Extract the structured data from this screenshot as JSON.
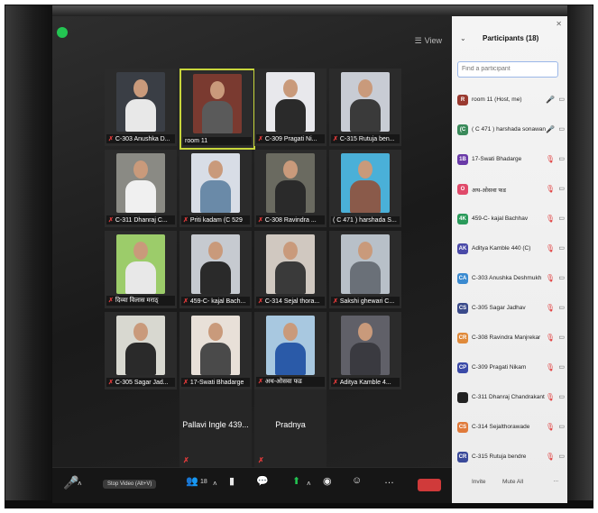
{
  "view_label": "View",
  "gallery": [
    {
      "name": "C-303 Anushka D...",
      "muted": true,
      "bg": "#3a3e45",
      "shirt": "#e8e8e8",
      "active": false
    },
    {
      "name": "room 11",
      "muted": false,
      "bg": "#7a3a30",
      "shirt": "#5a5a5a",
      "active": true
    },
    {
      "name": "C-309 Pragati Ni...",
      "muted": true,
      "bg": "#e8e8ec",
      "shirt": "#2a2a2a",
      "active": false
    },
    {
      "name": "C-315 Rutuja ben...",
      "muted": true,
      "bg": "#c8ccd4",
      "shirt": "#3a3a3a",
      "active": false
    },
    {
      "name": "C-311 Dhanraj C...",
      "muted": true,
      "bg": "#8a8a84",
      "shirt": "#f0f0f0",
      "active": false
    },
    {
      "name": "Priti kadam (C 529",
      "muted": true,
      "bg": "#d8dde6",
      "shirt": "#6a8aa8",
      "active": false
    },
    {
      "name": "C-308 Ravindra ...",
      "muted": true,
      "bg": "#6a6a60",
      "shirt": "#2a2a2a",
      "active": false
    },
    {
      "name": "( C 471 ) harshada S...",
      "muted": false,
      "bg": "#4ab0d8",
      "shirt": "#8a5a4a",
      "active": false
    },
    {
      "name": "दिव्या विलास मराठ्",
      "muted": true,
      "bg": "#9ccc6a",
      "shirt": "#e8e8e8",
      "active": false
    },
    {
      "name": "459-C- kajal Bach...",
      "muted": true,
      "bg": "#c6cad0",
      "shirt": "#2a2a2a",
      "active": false
    },
    {
      "name": "C-314 Sejal thora...",
      "muted": true,
      "bg": "#d0c8c0",
      "shirt": "#3a3a3a",
      "active": false
    },
    {
      "name": "Sakshi ghewari C...",
      "muted": true,
      "bg": "#b8c0c8",
      "shirt": "#6a7078",
      "active": false
    },
    {
      "name": "C-305 Sagar Jad...",
      "muted": true,
      "bg": "#d8d8d0",
      "shirt": "#2a2a2a",
      "active": false
    },
    {
      "name": "17-Swati Bhadarge",
      "muted": true,
      "bg": "#e8e0d8",
      "shirt": "#4a4a4a",
      "active": false
    },
    {
      "name": "अथ-ओसवा फड",
      "muted": true,
      "bg": "#a8c8e0",
      "shirt": "#2a5aa8",
      "active": false
    },
    {
      "name": "Aditya Kamble 4...",
      "muted": true,
      "bg": "#606068",
      "shirt": "#3a3a40",
      "active": false
    }
  ],
  "text_tiles": [
    "Pallavi Ingle 439...",
    "Pradnya"
  ],
  "toolbar": {
    "stop_video": "Stop Video (Alt+V)",
    "participants_count": "18"
  },
  "panel": {
    "title": "Participants (18)",
    "search_placeholder": "Find a participant",
    "invite": "Invite",
    "mute_all": "Mute All",
    "more": "...",
    "participants": [
      {
        "initial": "R",
        "name": "room 11 (Host, me)",
        "color": "#9a3a30",
        "muted": false
      },
      {
        "initial": "(C",
        "name": "( C 471 ) harshada sonawane",
        "color": "#3a8a5a",
        "muted": false
      },
      {
        "initial": "1B",
        "name": "17-Swati Bhadarge",
        "color": "#6a3aa8",
        "muted": true
      },
      {
        "initial": "O",
        "name": "अथ-ओसवा फड",
        "color": "#e04a6a",
        "muted": true
      },
      {
        "initial": "4K",
        "name": "459-C- kajal Bachhav",
        "color": "#2a9a5a",
        "muted": true
      },
      {
        "initial": "AK",
        "name": "Aditya Kamble 440 (C)",
        "color": "#4a4aa8",
        "muted": true
      },
      {
        "initial": "CA",
        "name": "C-303 Anushka Deshmukh",
        "color": "#3a8ad0",
        "muted": true
      },
      {
        "initial": "CS",
        "name": "C-305 Sagar Jadhav",
        "color": "#3a4a8a",
        "muted": true
      },
      {
        "initial": "CR",
        "name": "C-308 Ravindra Manjrekar",
        "color": "#e08a3a",
        "muted": true
      },
      {
        "initial": "CP",
        "name": "C-309 Pragati Nikam",
        "color": "#3a4aa8",
        "muted": true
      },
      {
        "initial": "",
        "name": "C-311 Dhanraj Chandrakant Salu",
        "color": "#222222",
        "muted": true
      },
      {
        "initial": "CS",
        "name": "C-314 Sejalthorawade",
        "color": "#e07a3a",
        "muted": true
      },
      {
        "initial": "CR",
        "name": "C-315 Rutuja bendre",
        "color": "#3a4a9a",
        "muted": true
      }
    ]
  }
}
